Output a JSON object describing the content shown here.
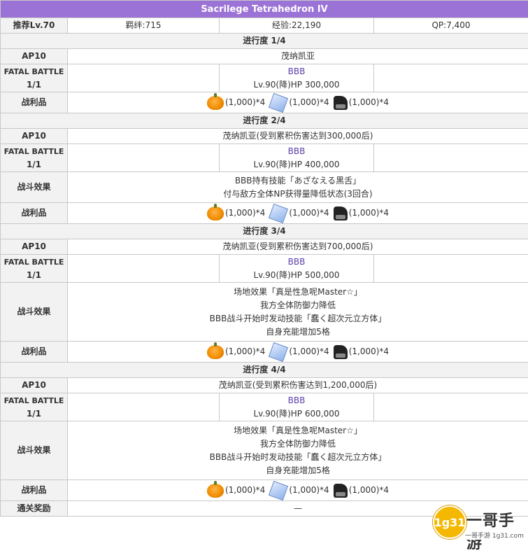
{
  "title": "Sacrilege Tetrahedron IV",
  "summary": {
    "level": "推荐Lv.70",
    "bond": "羁绊:715",
    "exp": "经验:22,190",
    "qp": "QP:7,400"
  },
  "labels": {
    "ap": "AP10",
    "fatal_line1": "FATAL BATTLE",
    "fatal_line2": "1/1",
    "drops": "战利品",
    "effects": "战斗效果",
    "clear_reward": "通关奖励"
  },
  "drop_text": "(1,000)*4",
  "drop_icons": [
    "pumpkin-icon",
    "cube-icon",
    "mask-icon"
  ],
  "stages": [
    {
      "progress": "进行度 1/4",
      "place": "茂纳凯亚",
      "enemy_name": "BBB",
      "enemy_stats": "Lv.90(降)HP 300,000",
      "effects": []
    },
    {
      "progress": "进行度 2/4",
      "place": "茂纳凯亚(受到累积伤害达到300,000后)",
      "enemy_name": "BBB",
      "enemy_stats": "Lv.90(降)HP 400,000",
      "effects": [
        "BBB持有技能「あざなえる黒舌」",
        "付与敌方全体NP获得量降低状态(3回合)"
      ]
    },
    {
      "progress": "进行度 3/4",
      "place": "茂纳凯亚(受到累积伤害达到700,000后)",
      "enemy_name": "BBB",
      "enemy_stats": "Lv.90(降)HP 500,000",
      "effects": [
        "场地效果「真是性急呢Master☆」",
        "我方全体防御力降低",
        "BBB战斗开始时发动技能「蠢く超次元立方体」",
        "自身充能增加5格"
      ]
    },
    {
      "progress": "进行度 4/4",
      "place": "茂纳凯亚(受到累积伤害达到1,200,000后)",
      "enemy_name": "BBB",
      "enemy_stats": "Lv.90(降)HP 600,000",
      "effects": [
        "场地效果「真是性急呢Master☆」",
        "我方全体防御力降低",
        "BBB战斗开始时发动技能「蠢く超次元立方体」",
        "自身充能增加5格"
      ]
    }
  ],
  "clear_reward_value": "—",
  "watermark": {
    "circle_text": "1g31",
    "brand": "一哥手游",
    "url": "一哥手游 1g31.com"
  },
  "colors": {
    "title_bg": "#9b72d6",
    "enemy_name": "#5a3fa8",
    "label_bg": "#f2f2f2"
  }
}
